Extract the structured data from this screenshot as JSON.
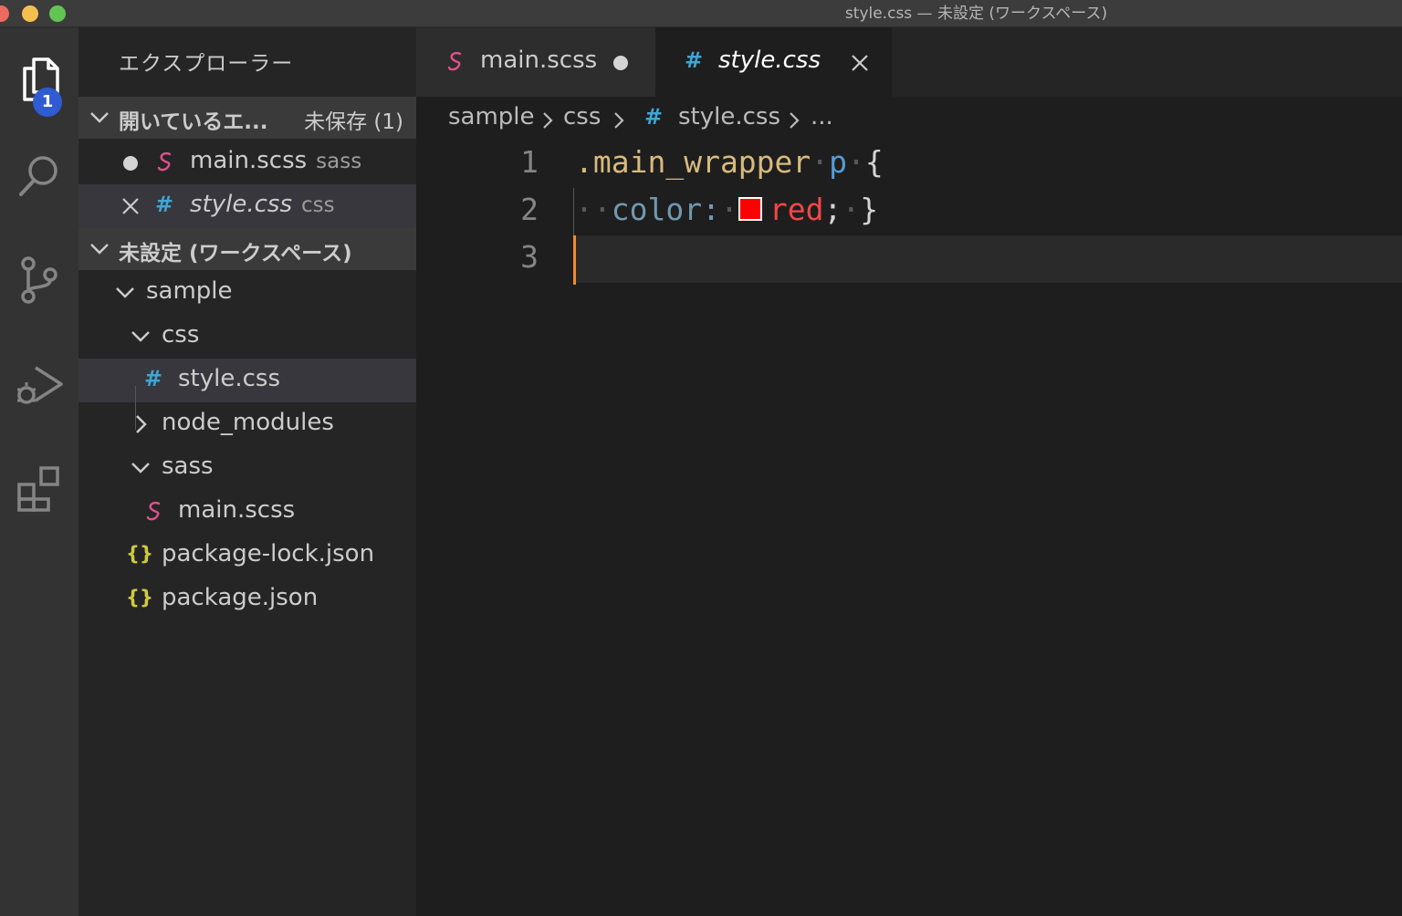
{
  "window": {
    "title": "style.css — 未設定 (ワークスペース)"
  },
  "activity_bar": {
    "items": [
      {
        "icon": "files-icon",
        "badge": "1"
      },
      {
        "icon": "search-icon"
      },
      {
        "icon": "source-control-icon"
      },
      {
        "icon": "run-debug-icon"
      },
      {
        "icon": "extensions-icon"
      }
    ]
  },
  "sidebar": {
    "title": "エクスプローラー",
    "open_editors": {
      "label": "開いているエ...",
      "unsaved": "未保存 (1)",
      "items": [
        {
          "name": "main.scss",
          "detail": "sass",
          "icon": "sass-icon",
          "state": "modified"
        },
        {
          "name": "style.css",
          "detail": "css",
          "icon": "css-icon",
          "state": "close"
        }
      ]
    },
    "workspace": {
      "label": "未設定 (ワークスペース)",
      "tree": [
        {
          "name": "sample",
          "kind": "folder-open"
        },
        {
          "name": "css",
          "kind": "folder-open"
        },
        {
          "name": "style.css",
          "kind": "css",
          "selected": true
        },
        {
          "name": "node_modules",
          "kind": "folder-closed"
        },
        {
          "name": "sass",
          "kind": "folder-open"
        },
        {
          "name": "main.scss",
          "kind": "sass"
        },
        {
          "name": "package-lock.json",
          "kind": "json"
        },
        {
          "name": "package.json",
          "kind": "json"
        }
      ]
    }
  },
  "tabs": [
    {
      "label": "main.scss",
      "icon": "sass-icon",
      "state": "modified",
      "active": false
    },
    {
      "label": "style.css",
      "icon": "css-icon",
      "state": "close",
      "active": true
    }
  ],
  "breadcrumb": [
    "sample",
    "css",
    "style.css",
    "..."
  ],
  "editor": {
    "line_numbers": [
      "1",
      "2",
      "3"
    ],
    "tokens": {
      "selector": ".main_wrapper",
      "tag": "p",
      "brace_open": "{",
      "property": "color:",
      "value": "red",
      "semicolon": ";",
      "brace_close": "}",
      "swatch_color": "#ff0000"
    }
  },
  "colors": {
    "accent_badge": "#2f5bd3",
    "css_icon": "#3ea6d6",
    "sass_icon": "#e0518a",
    "json_icon": "#cbcb41",
    "cursor": "#f28c28"
  }
}
